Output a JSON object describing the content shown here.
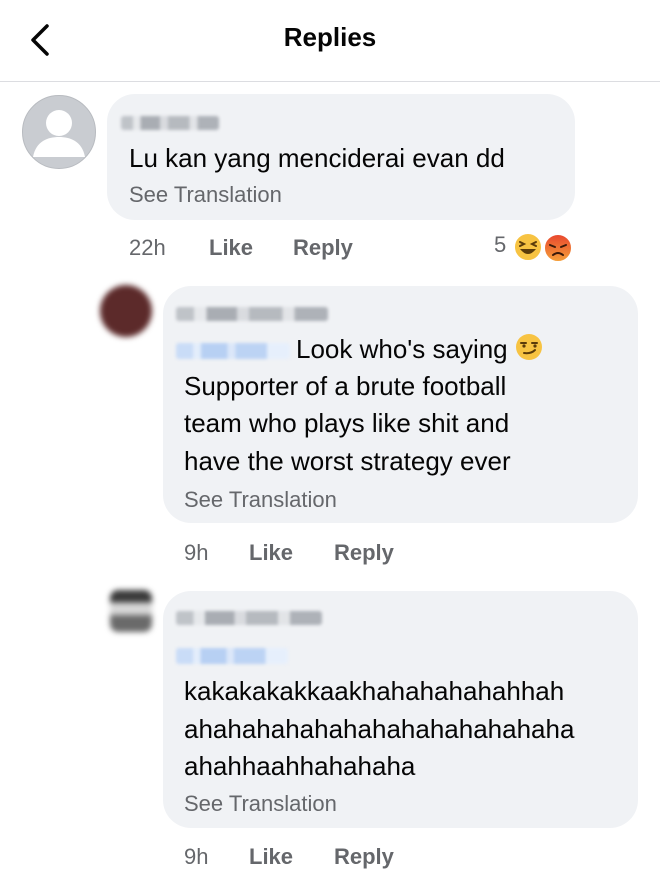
{
  "header": {
    "title": "Replies"
  },
  "comments": [
    {
      "text": "Lu kan yang menciderai evan dd",
      "see_translation": "See Translation",
      "time": "22h",
      "like": "Like",
      "reply": "Reply",
      "reaction_count": "5",
      "reactions": [
        "laugh-emoji",
        "angry-emoji"
      ]
    },
    {
      "lines": [
        "Look who's saying",
        "Supporter of a brute football",
        "team who plays like shit and",
        "have the worst strategy ever"
      ],
      "inline_emoji": "smirk-emoji",
      "see_translation": "See Translation",
      "time": "9h",
      "like": "Like",
      "reply": "Reply"
    },
    {
      "lines": [
        "kakakakakkaakhahahahahahhah",
        "ahahahahahahahahahahahahaha",
        "ahahhaahhahahaha"
      ],
      "see_translation": "See Translation",
      "time": "9h",
      "like": "Like",
      "reply": "Reply"
    }
  ]
}
